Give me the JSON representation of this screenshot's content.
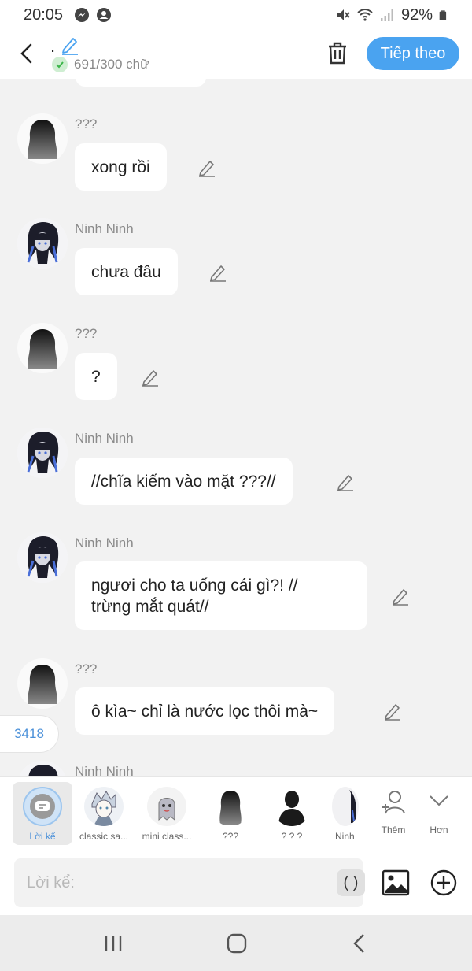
{
  "status_bar": {
    "time": "20:05",
    "battery": "92%"
  },
  "header": {
    "title": ".",
    "word_count": "691/300 chữ",
    "next_label": "Tiếp theo"
  },
  "messages": [
    {
      "sender": "???",
      "text": "xong rồi",
      "avatar": "dark-silhouette"
    },
    {
      "sender": "Ninh Ninh",
      "text": "chưa đâu",
      "avatar": "anime-girl-dark-hair"
    },
    {
      "sender": "???",
      "text": "?",
      "avatar": "dark-silhouette"
    },
    {
      "sender": "Ninh Ninh",
      "text": "//chĩa kiếm vào mặt ???//",
      "avatar": "anime-girl-dark-hair"
    },
    {
      "sender": "Ninh Ninh",
      "text_line1": "ngươi cho ta uống cái gì?! //",
      "text_line2": "trừng mắt quát//",
      "avatar": "anime-girl-dark-hair"
    },
    {
      "sender": "???",
      "text": "ô kìa~ chỉ là nước lọc thôi mà~",
      "avatar": "dark-silhouette"
    },
    {
      "sender": "Ninh Ninh",
      "avatar": "anime-girl-dark-hair"
    }
  ],
  "counter_badge": "3418",
  "characters": [
    {
      "label": "Lời kể",
      "icon": "narration-icon",
      "active": true
    },
    {
      "label": "classic sa...",
      "icon": "anime-boy-avatar"
    },
    {
      "label": "mini class...",
      "icon": "ghost-avatar"
    },
    {
      "label": "???",
      "icon": "dark-silhouette"
    },
    {
      "label": "? ? ?",
      "icon": "dark-silhouette-man"
    },
    {
      "label": "Ninh",
      "icon": "anime-girl-dark-hair"
    }
  ],
  "char_actions": {
    "add_label": "Thêm",
    "more_label": "Hơn"
  },
  "input": {
    "placeholder": "Lời kể:",
    "paren_label": "( )"
  },
  "colors": {
    "accent": "#4aa3f0",
    "background": "#f2f2f2",
    "bubble": "#ffffff"
  }
}
